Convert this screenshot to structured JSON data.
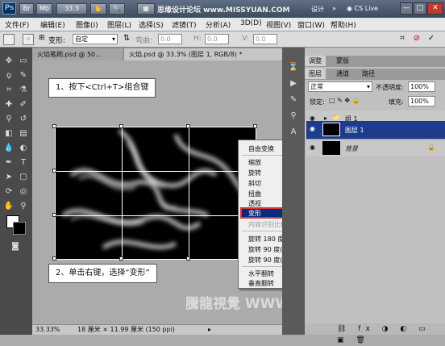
{
  "titlebar": {
    "logo": "Ps",
    "br": "Br",
    "mb": "Mb",
    "zoom": "33.3",
    "workspace": "设计",
    "cs_live": "CS Live",
    "minimize": "—",
    "maximize": "□",
    "close": "✕"
  },
  "watermark_top": "思缘设计论坛  www.MISSYUAN.COM",
  "watermark_bottom": "騰龍視覺 WWW.TLVI.NET",
  "menu": [
    "文件(F)",
    "编辑(E)",
    "图像(I)",
    "图层(L)",
    "选择(S)",
    "滤镜(T)",
    "分析(A)",
    "3D(D)",
    "视图(V)",
    "窗口(W)",
    "帮助(H)"
  ],
  "options": {
    "label": "变形:",
    "preset": "自定",
    "field1": "0.0",
    "field2": "0.0",
    "field3": "0.0"
  },
  "tabs": [
    "火焰笔刷.psd @ 50...",
    "火焰.psd @ 33.3% (图层 1, RGB/8) *"
  ],
  "callout1": "1、按下<Ctrl+T>组合键",
  "callout2": "2、单击右键，选择“变形”",
  "context_menu": [
    "自由变换",
    "缩放",
    "旋转",
    "斜切",
    "扭曲",
    "透视",
    "变形",
    "内容识别比例",
    "旋转 180 度",
    "旋转 90 度(顺时针)",
    "旋转 90 度(逆时针)",
    "水平翻转",
    "垂直翻转"
  ],
  "status": {
    "zoom": "33.33%",
    "size": "18 厘米 × 11.99 厘米 (150 ppi)"
  },
  "panels": {
    "tab1": "调整",
    "tab2": "蒙版",
    "tab3": "图层",
    "tab4": "通道",
    "tab5": "路径",
    "blend": "正常",
    "opacity_label": "不透明度:",
    "opacity": "100%",
    "lock_label": "锁定:",
    "fill_label": "填充:",
    "fill": "100%",
    "layers": [
      "组 1",
      "图层 1",
      "背景"
    ]
  }
}
